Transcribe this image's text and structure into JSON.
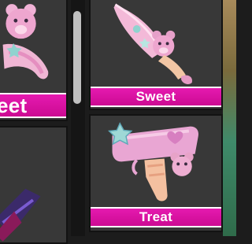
{
  "inventory": {
    "items": [
      {
        "label": "eet"
      },
      {
        "label": ""
      },
      {
        "label": "Sweet"
      },
      {
        "label": "Treat"
      }
    ]
  },
  "colors": {
    "label_bar": "#d70f9e",
    "card_bg": "#383838",
    "scroll_thumb": "#bfbfbf"
  }
}
